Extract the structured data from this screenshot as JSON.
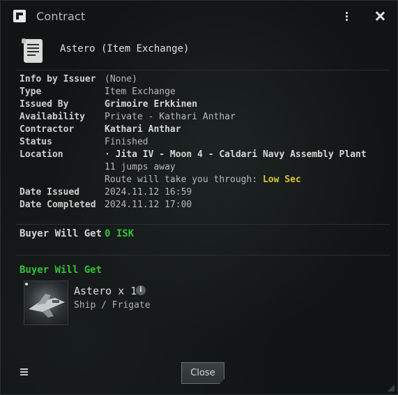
{
  "window": {
    "title": "Contract"
  },
  "contract": {
    "name": "Astero (Item Exchange)"
  },
  "info": [
    {
      "label": "Info by Issuer",
      "value": "(None)"
    },
    {
      "label": "Type",
      "value": "Item Exchange"
    },
    {
      "label": "Issued By",
      "value": "Grimoire Erkkinen"
    },
    {
      "label": "Availability",
      "value": "Private - Kathari Anthar"
    },
    {
      "label": "Contractor",
      "value": "Kathari Anthar"
    },
    {
      "label": "Status",
      "value": "Finished"
    },
    {
      "label": "Location",
      "value": "· Jita IV - Moon 4 - Caldari Navy Assembly Plant"
    },
    {
      "label": "",
      "value": "11 jumps away"
    },
    {
      "label": "",
      "value": "Route will take you through:",
      "highlight": "Low Sec"
    },
    {
      "label": "Date Issued",
      "value": "2024.11.12 16:59"
    },
    {
      "label": "Date Completed",
      "value": "2024.11.12 17:00"
    }
  ],
  "buyer_isk": {
    "label": "Buyer Will Get",
    "value": "0 ISK"
  },
  "items_section": {
    "title": "Buyer Will Get"
  },
  "item": {
    "name": "Astero x 1",
    "type": "Ship / Frigate",
    "icon": "frigate-ship-icon"
  },
  "buttons": {
    "close": "Close"
  },
  "colors": {
    "accent_green": "#2fc23a",
    "lowsec_yellow": "#d9c62d",
    "background": "#111415"
  }
}
